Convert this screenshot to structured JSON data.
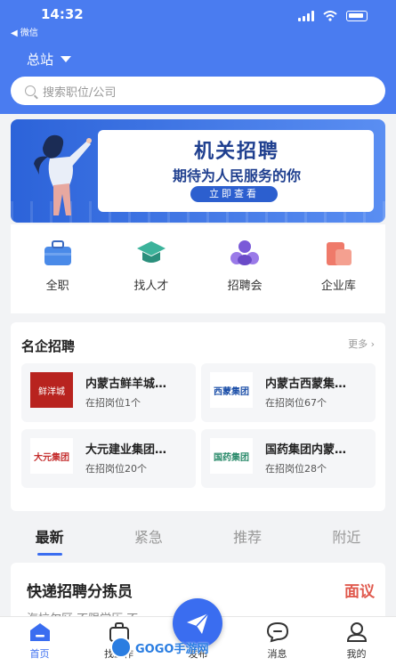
{
  "status_bar": {
    "time": "14:32",
    "back_app": "◀ 微信"
  },
  "header": {
    "station": "总站"
  },
  "search": {
    "placeholder": "搜索职位/公司"
  },
  "banner": {
    "title": "机关招聘",
    "subtitle": "期待为人民服务的你",
    "button": "立即查看"
  },
  "categories": [
    {
      "label": "全职",
      "icon": "briefcase-icon"
    },
    {
      "label": "找人才",
      "icon": "graduation-cap-icon"
    },
    {
      "label": "招聘会",
      "icon": "group-icon"
    },
    {
      "label": "企业库",
      "icon": "building-icon"
    }
  ],
  "famous": {
    "title": "名企招聘",
    "more": "更多",
    "companies": [
      {
        "name": "内蒙古鲜羊城…",
        "jobs": "在招岗位1个",
        "logo_text": "鲜洋城"
      },
      {
        "name": "内蒙古西蒙集…",
        "jobs": "在招岗位67个",
        "logo_text": "西蒙集团"
      },
      {
        "name": "大元建业集团…",
        "jobs": "在招岗位20个",
        "logo_text": "大元集团"
      },
      {
        "name": "国药集团内蒙…",
        "jobs": "在招岗位28个",
        "logo_text": "国药集团"
      }
    ]
  },
  "tabs": [
    "最新",
    "紧急",
    "推荐",
    "附近"
  ],
  "job": {
    "title": "快递招聘分拣员",
    "salary": "面议",
    "tags": "海拉尔区  不限学历  不…"
  },
  "nav": [
    {
      "label": "首页",
      "icon": "home-icon"
    },
    {
      "label": "找工作",
      "icon": "bag-icon"
    },
    {
      "label": "发布",
      "icon": "send-icon"
    },
    {
      "label": "消息",
      "icon": "message-icon"
    },
    {
      "label": "我的",
      "icon": "user-icon"
    }
  ],
  "watermark": "GOGO手游网",
  "colors": {
    "primary": "#4a7cf0",
    "accent": "#3a6df0",
    "salary": "#e05a4e"
  }
}
